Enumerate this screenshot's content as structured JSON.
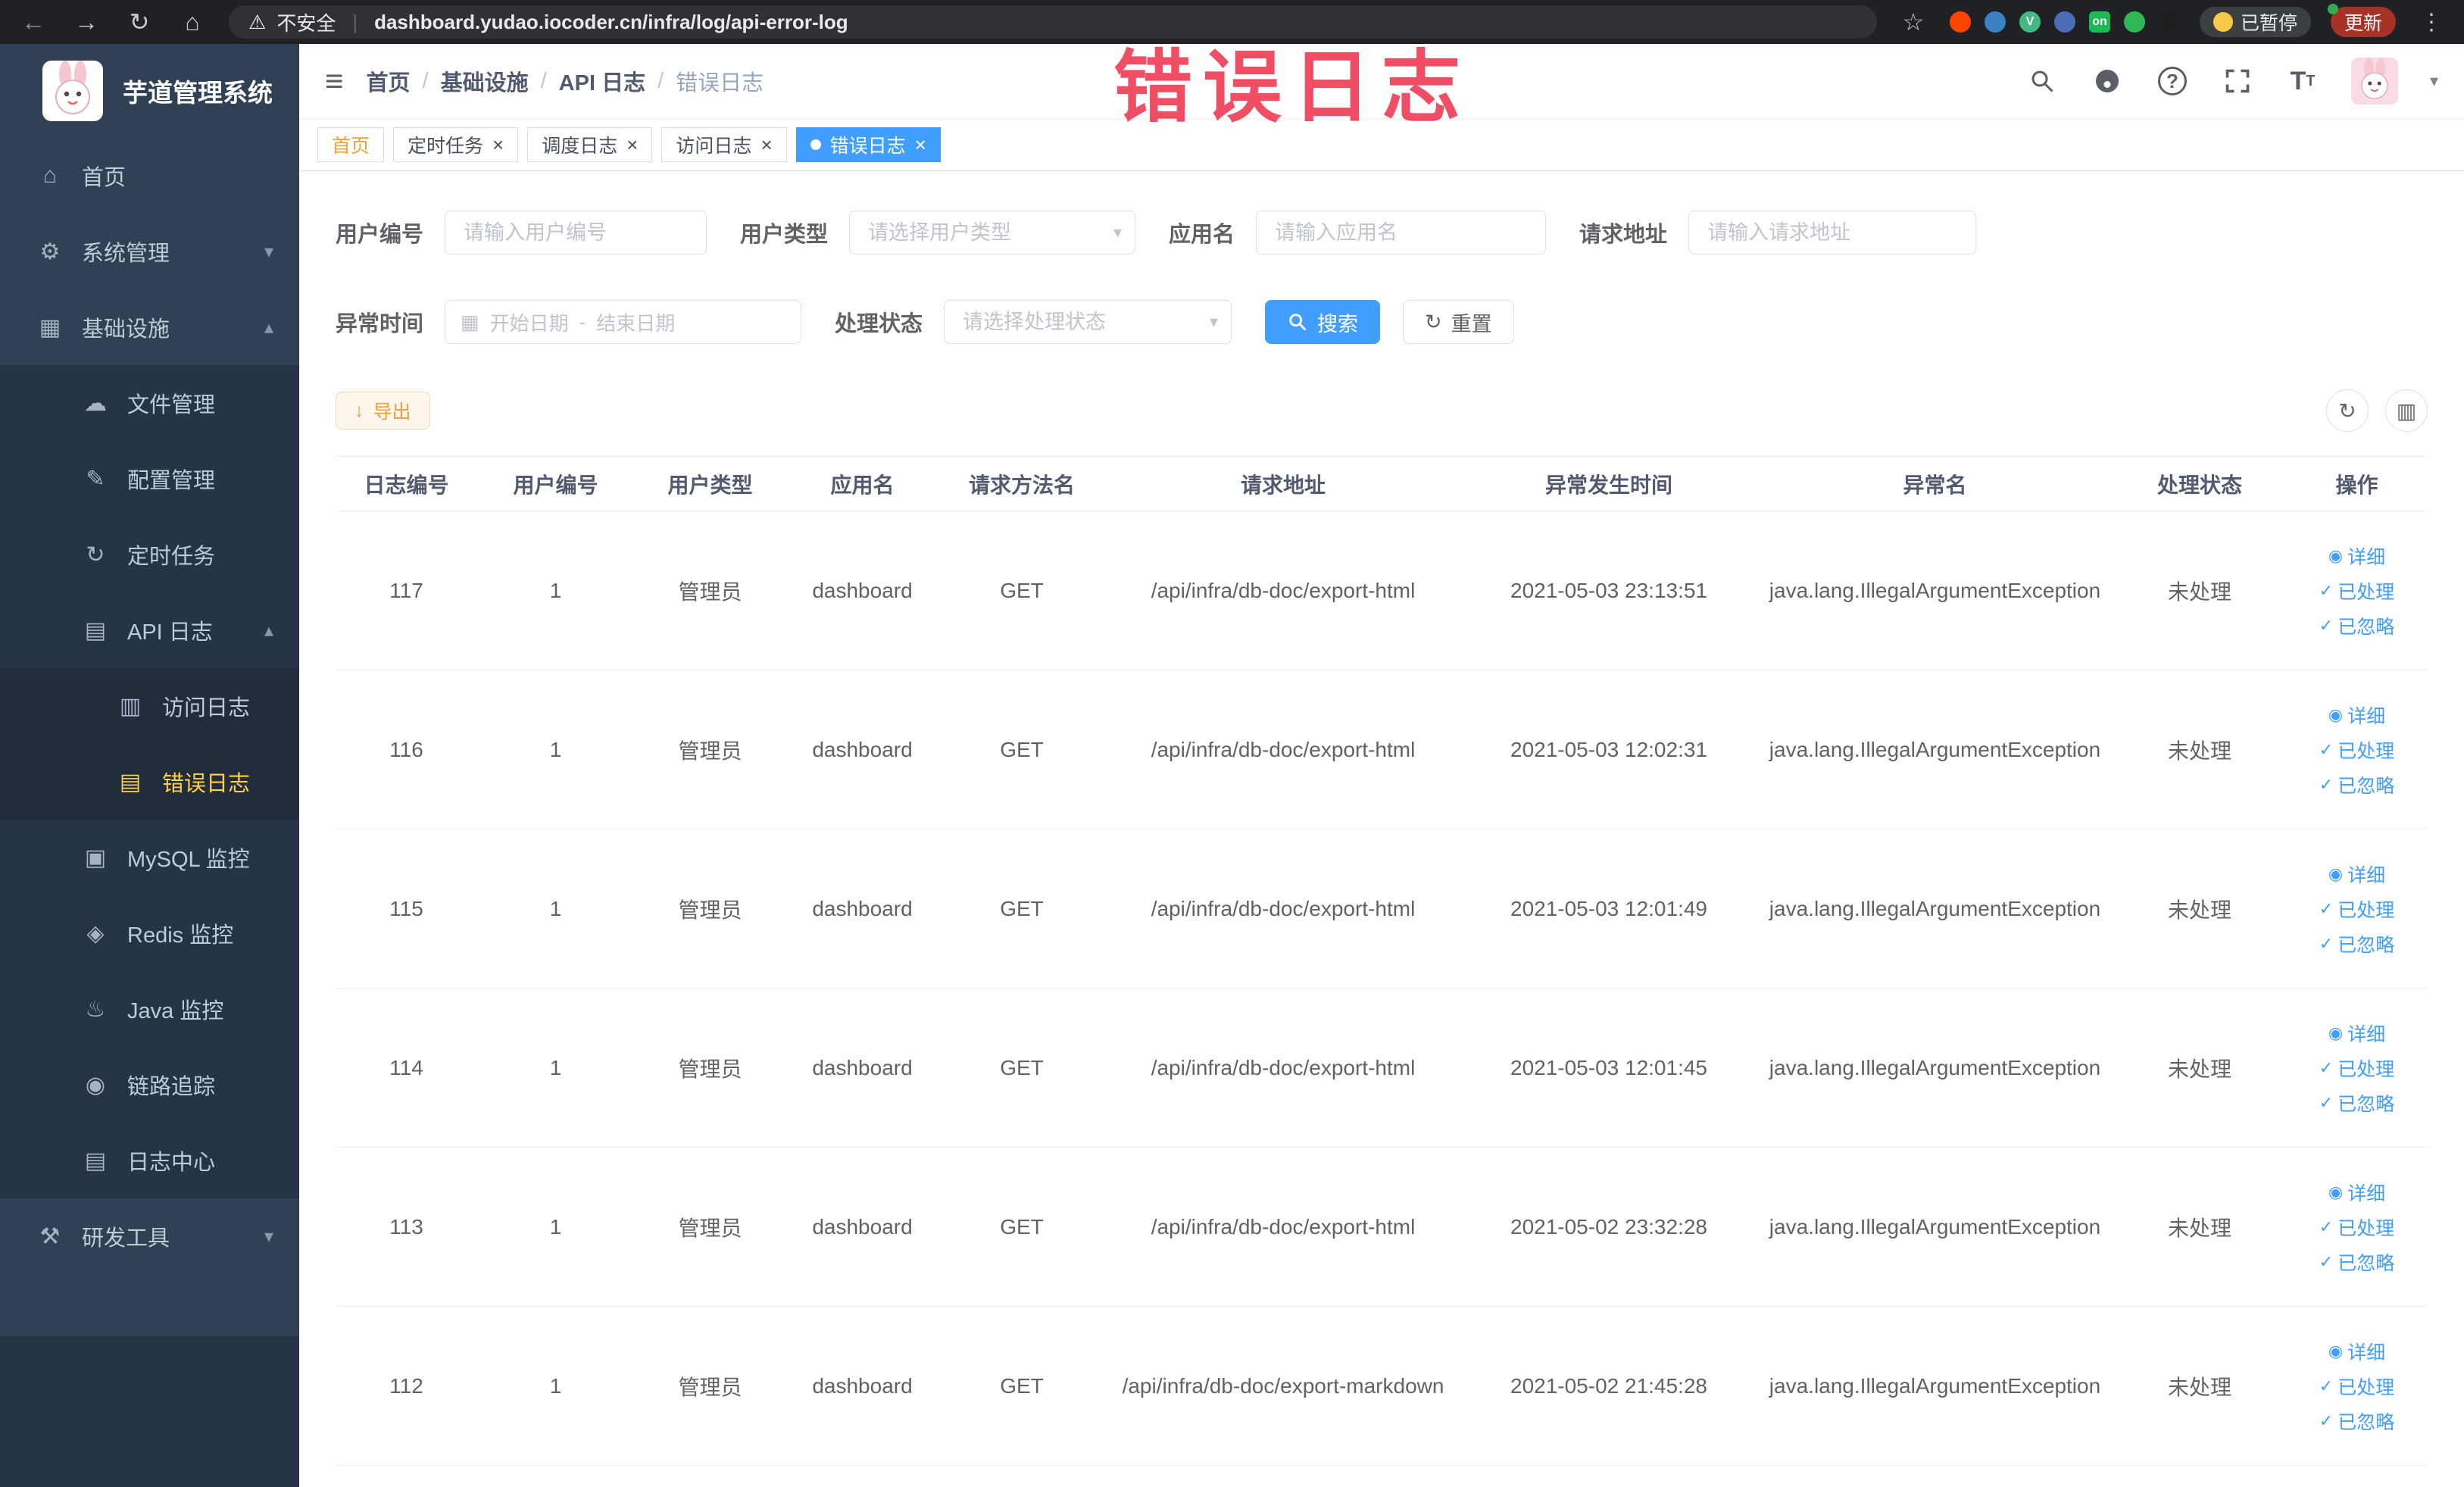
{
  "browser": {
    "security_label": "不安全",
    "url": "dashboard.yudao.iocoder.cn/infra/log/api-error-log",
    "paused_badge": "已暂停",
    "update_button": "更新",
    "extensions": [
      {
        "key": "reddit",
        "color": "#ff4500",
        "shape": "circle",
        "label": ""
      },
      {
        "key": "drop",
        "color": "#3b82c4",
        "shape": "circle",
        "label": ""
      },
      {
        "key": "vue-devtools",
        "color": "#42b883",
        "shape": "circle",
        "label": "V"
      },
      {
        "key": "grid",
        "color": "#4b6cb7",
        "shape": "circle",
        "label": ""
      },
      {
        "key": "screen-on",
        "color": "#1db954",
        "shape": "square",
        "label": "on"
      },
      {
        "key": "leaf",
        "color": "#30b856",
        "shape": "circle",
        "label": ""
      },
      {
        "key": "tampermonkey",
        "color": "#1f1f1f",
        "shape": "square",
        "label": ""
      }
    ]
  },
  "annotation": {
    "watermark": "错误日志"
  },
  "sidebar": {
    "logo_title": "芋道管理系统",
    "items": [
      {
        "key": "home",
        "label": "首页",
        "icon": "home-icon",
        "glyph": "⌂",
        "level": 1
      },
      {
        "key": "system-mgmt",
        "label": "系统管理",
        "icon": "gear-icon",
        "glyph": "⚙",
        "level": 1,
        "arrow": "down"
      },
      {
        "key": "infra",
        "label": "基础设施",
        "icon": "infra-icon",
        "glyph": "▦",
        "level": 1,
        "arrow": "up"
      },
      {
        "key": "file-mgmt",
        "label": "文件管理",
        "icon": "cloud-icon",
        "glyph": "☁",
        "level": 2
      },
      {
        "key": "config-mgmt",
        "label": "配置管理",
        "icon": "edit-icon",
        "glyph": "✎",
        "level": 2
      },
      {
        "key": "cron-job",
        "label": "定时任务",
        "icon": "clock-icon",
        "glyph": "↻",
        "level": 2
      },
      {
        "key": "api-log",
        "label": "API 日志",
        "icon": "doc-icon",
        "glyph": "▤",
        "level": 2,
        "arrow": "up"
      },
      {
        "key": "access-log",
        "label": "访问日志",
        "icon": "doc-icon",
        "glyph": "▥",
        "level": 3
      },
      {
        "key": "error-log",
        "label": "错误日志",
        "icon": "doc-icon",
        "glyph": "▤",
        "level": 3,
        "active": true
      },
      {
        "key": "mysql-monitor",
        "label": "MySQL 监控",
        "icon": "monitor-icon",
        "glyph": "▣",
        "level": 2
      },
      {
        "key": "redis-monitor",
        "label": "Redis 监控",
        "icon": "database-icon",
        "glyph": "◈",
        "level": 2
      },
      {
        "key": "java-monitor",
        "label": "Java 监控",
        "icon": "coffee-icon",
        "glyph": "♨",
        "level": 2
      },
      {
        "key": "trace",
        "label": "链路追踪",
        "icon": "eye-icon",
        "glyph": "◉",
        "level": 2
      },
      {
        "key": "log-center",
        "label": "日志中心",
        "icon": "log-icon",
        "glyph": "▤",
        "level": 2
      },
      {
        "key": "dev-tools",
        "label": "研发工具",
        "icon": "tools-icon",
        "glyph": "⚒",
        "level": 1,
        "arrow": "down"
      }
    ]
  },
  "breadcrumb": {
    "items": [
      "首页",
      "基础设施",
      "API 日志",
      "错误日志"
    ],
    "separator": "/"
  },
  "tabs": [
    {
      "key": "home",
      "label": "首页",
      "closable": false,
      "active": false,
      "text_color": "#e6a23c"
    },
    {
      "key": "cron-job",
      "label": "定时任务",
      "closable": true,
      "active": false
    },
    {
      "key": "schedule-log",
      "label": "调度日志",
      "closable": true,
      "active": false
    },
    {
      "key": "access-log",
      "label": "访问日志",
      "closable": true,
      "active": false
    },
    {
      "key": "error-log",
      "label": "错误日志",
      "closable": true,
      "active": true
    }
  ],
  "filters": {
    "user_id": {
      "label": "用户编号",
      "placeholder": "请输入用户编号"
    },
    "user_type": {
      "label": "用户类型",
      "placeholder": "请选择用户类型"
    },
    "app_name": {
      "label": "应用名",
      "placeholder": "请输入应用名"
    },
    "request_url": {
      "label": "请求地址",
      "placeholder": "请输入请求地址"
    },
    "exception_time": {
      "label": "异常时间",
      "start_placeholder": "开始日期",
      "separator": "-",
      "end_placeholder": "结束日期"
    },
    "process_status": {
      "label": "处理状态",
      "placeholder": "请选择处理状态"
    },
    "search_button": "搜索",
    "reset_button": "重置"
  },
  "toolbar": {
    "export_button": "导出"
  },
  "table": {
    "columns": [
      "日志编号",
      "用户编号",
      "用户类型",
      "应用名",
      "请求方法名",
      "请求地址",
      "异常发生时间",
      "异常名",
      "处理状态",
      "操作"
    ],
    "actions": [
      "详细",
      "已处理",
      "已忽略"
    ],
    "rows": [
      {
        "id": "117",
        "user_id": "1",
        "user_type": "管理员",
        "app": "dashboard",
        "method": "GET",
        "url": "/api/infra/db-doc/export-html",
        "time": "2021-05-03 23:13:51",
        "exception": "java.lang.IllegalArgumentException",
        "status": "未处理"
      },
      {
        "id": "116",
        "user_id": "1",
        "user_type": "管理员",
        "app": "dashboard",
        "method": "GET",
        "url": "/api/infra/db-doc/export-html",
        "time": "2021-05-03 12:02:31",
        "exception": "java.lang.IllegalArgumentException",
        "status": "未处理"
      },
      {
        "id": "115",
        "user_id": "1",
        "user_type": "管理员",
        "app": "dashboard",
        "method": "GET",
        "url": "/api/infra/db-doc/export-html",
        "time": "2021-05-03 12:01:49",
        "exception": "java.lang.IllegalArgumentException",
        "status": "未处理"
      },
      {
        "id": "114",
        "user_id": "1",
        "user_type": "管理员",
        "app": "dashboard",
        "method": "GET",
        "url": "/api/infra/db-doc/export-html",
        "time": "2021-05-03 12:01:45",
        "exception": "java.lang.IllegalArgumentException",
        "status": "未处理"
      },
      {
        "id": "113",
        "user_id": "1",
        "user_type": "管理员",
        "app": "dashboard",
        "method": "GET",
        "url": "/api/infra/db-doc/export-html",
        "time": "2021-05-02 23:32:28",
        "exception": "java.lang.IllegalArgumentException",
        "status": "未处理"
      },
      {
        "id": "112",
        "user_id": "1",
        "user_type": "管理员",
        "app": "dashboard",
        "method": "GET",
        "url": "/api/infra/db-doc/export-markdown",
        "time": "2021-05-02 21:45:28",
        "exception": "java.lang.IllegalArgumentException",
        "status": "未处理"
      }
    ]
  },
  "colors": {
    "accent": "#409eff",
    "sidebar_active": "#ffd04b",
    "warning": "#e6a23c",
    "watermark": "#ee3f58"
  }
}
